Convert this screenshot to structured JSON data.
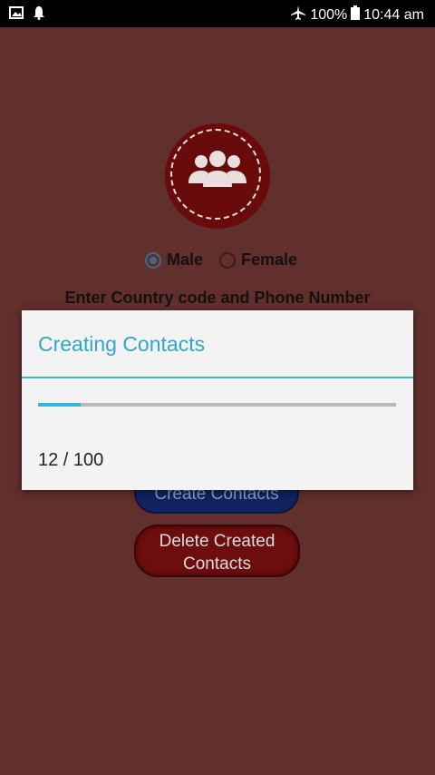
{
  "status_bar": {
    "battery": "100%",
    "time": "10:44 am"
  },
  "form": {
    "gender_options": [
      {
        "label": "Male",
        "checked": true
      },
      {
        "label": "Female",
        "checked": false
      }
    ],
    "prompt": "Enter Country code and Phone Number",
    "create_button": "Create Contacts",
    "delete_button_line1": "Delete Created",
    "delete_button_line2": "Contacts"
  },
  "dialog": {
    "title": "Creating Contacts",
    "progress_current": 12,
    "progress_max": 100,
    "progress_text": "12 / 100"
  },
  "colors": {
    "background": "#612f2c",
    "accent": "#33b5e5"
  }
}
